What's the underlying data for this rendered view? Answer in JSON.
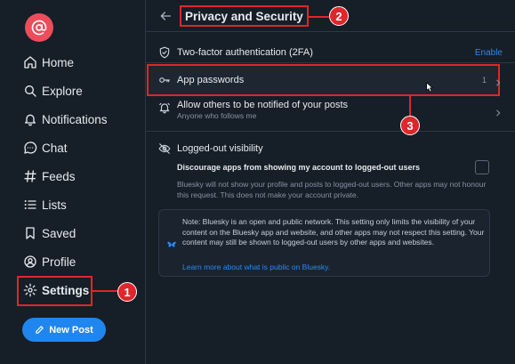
{
  "sidebar": {
    "items": [
      {
        "label": "Home",
        "icon": "home-icon"
      },
      {
        "label": "Explore",
        "icon": "search-icon"
      },
      {
        "label": "Notifications",
        "icon": "bell-icon"
      },
      {
        "label": "Chat",
        "icon": "chat-icon"
      },
      {
        "label": "Feeds",
        "icon": "hash-icon"
      },
      {
        "label": "Lists",
        "icon": "list-icon"
      },
      {
        "label": "Saved",
        "icon": "bookmark-icon"
      },
      {
        "label": "Profile",
        "icon": "user-circle-icon"
      },
      {
        "label": "Settings",
        "icon": "gear-icon"
      }
    ],
    "new_post_label": "New Post"
  },
  "header": {
    "title": "Privacy and Security"
  },
  "rows": {
    "two_factor": {
      "label": "Two-factor authentication (2FA)",
      "action": "Enable"
    },
    "app_passwords": {
      "label": "App passwords",
      "count": "1"
    },
    "notify": {
      "label": "Allow others to be notified of your posts",
      "sub": "Anyone who follows me"
    },
    "logged_out": {
      "label": "Logged-out visibility"
    }
  },
  "discourage": {
    "title": "Discourage apps from showing my account to logged-out users",
    "description": "Bluesky will not show your profile and posts to logged-out users. Other apps may not honour this request. This does not make your account private."
  },
  "note": {
    "text": "Note: Bluesky is an open and public network. This setting only limits the visibility of your content on the Bluesky app and website, and other apps may not respect this setting. Your content may still be shown to logged-out users by other apps and websites.",
    "link": "Learn more about what is public on Bluesky."
  },
  "callouts": [
    "1",
    "2",
    "3"
  ],
  "colors": {
    "accent": "#1f86f0",
    "annotation": "#e0262b",
    "avatar": "#ec4d5a",
    "background": "#161e27"
  }
}
